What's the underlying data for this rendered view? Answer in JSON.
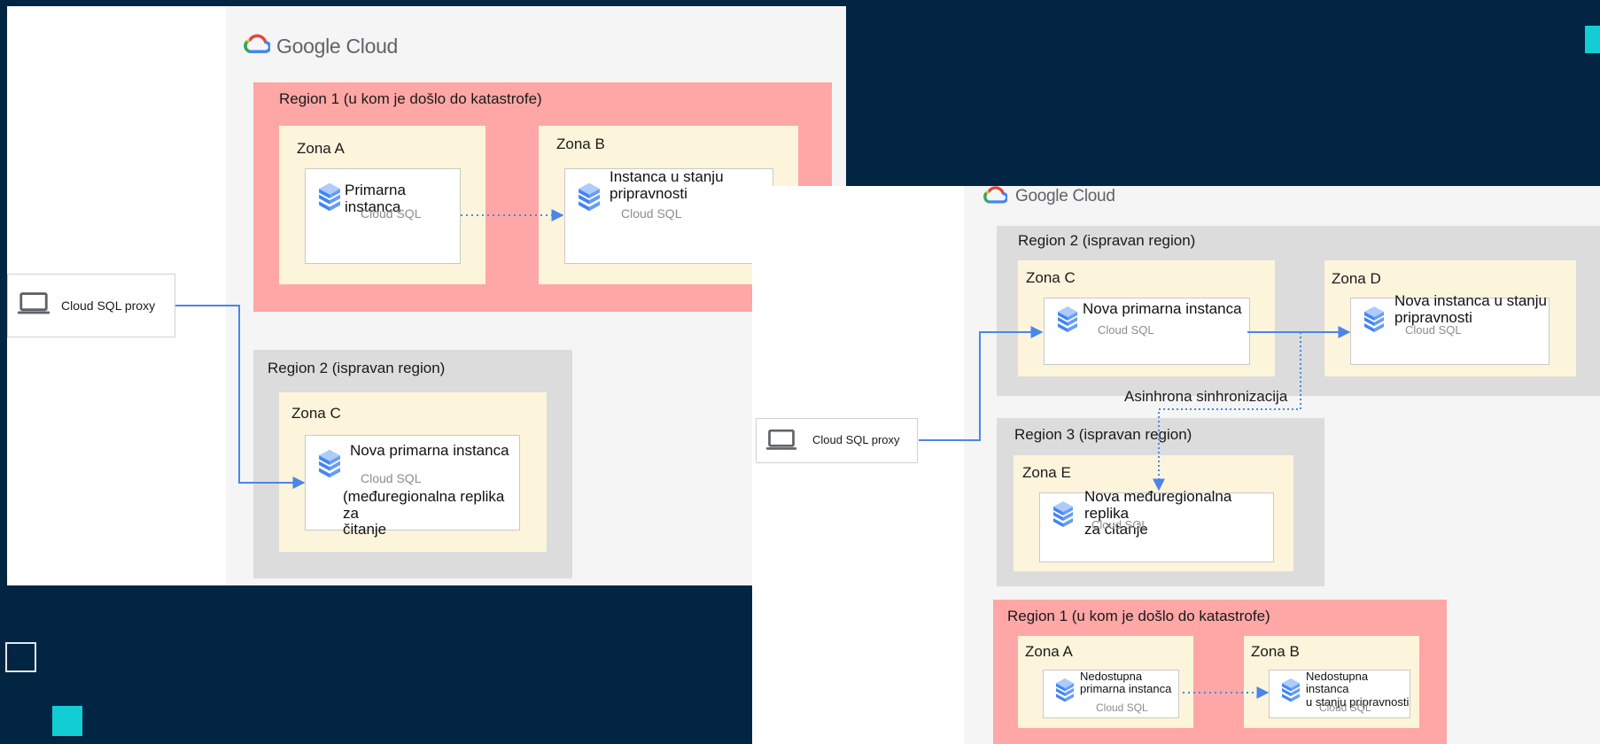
{
  "brand": {
    "name": "Google Cloud"
  },
  "colors": {
    "background": "#022544",
    "accent_cyan": "#12cdd4",
    "region_disaster": "#fea7a6",
    "region_healthy": "#dcdcdc",
    "zone": "#fdf4dc",
    "arrow": "#4a86e8"
  },
  "icons": [
    "google-cloud-logo",
    "laptop-icon",
    "cloud-sql-icon"
  ],
  "before": {
    "proxy_label": "Cloud SQL proxy",
    "region1": {
      "label": "Region 1 (u kom je došlo do katastrofe)",
      "zone_a": {
        "label": "Zona A",
        "instance": "Primarna instanca",
        "service": "Cloud SQL"
      },
      "zone_b": {
        "label": "Zona B",
        "instance": "Instanca u stanju\npripravnosti",
        "service": "Cloud SQL"
      }
    },
    "region2": {
      "label": "Region 2 (ispravan region)",
      "zone_c": {
        "label": "Zona C",
        "instance": "Nova primarna instanca",
        "service": "Cloud SQL",
        "note": "(međuregionalna replika za\nčitanje"
      }
    }
  },
  "after": {
    "proxy_label": "Cloud SQL proxy",
    "sync_label": "Asinhrona sinhronizacija",
    "region2": {
      "label": "Region 2 (ispravan region)",
      "zone_c": {
        "label": "Zona C",
        "instance": "Nova primarna instanca",
        "service": "Cloud SQL"
      },
      "zone_d": {
        "label": "Zona D",
        "instance": "Nova instanca u stanju\npripravnosti",
        "service": "Cloud SQL"
      }
    },
    "region3": {
      "label": "Region 3 (ispravan region)",
      "zone_e": {
        "label": "Zona E",
        "instance": "Nova međuregionalna replika\nza čitanje",
        "service": "Cloud SQL"
      }
    },
    "region1": {
      "label": "Region 1 (u kom je došlo do katastrofe)",
      "zone_a": {
        "label": "Zona A",
        "instance": "Nedostupna\nprimarna instanca",
        "service": "Cloud SQL"
      },
      "zone_b": {
        "label": "Zona B",
        "instance": "Nedostupna instanca\nu stanju pripravnosti",
        "service": "Cloud SQL"
      }
    }
  }
}
